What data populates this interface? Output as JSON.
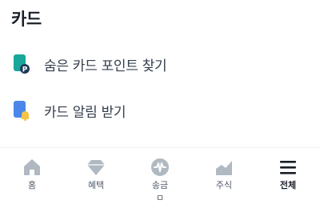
{
  "section": {
    "title": "카드"
  },
  "menu": [
    {
      "label": "숨은 카드 포인트 찾기",
      "icon": "card-point-icon"
    },
    {
      "label": "카드 알림 받기",
      "icon": "card-notification-icon"
    }
  ],
  "tabbar": {
    "tabs": [
      {
        "label": "홈",
        "icon": "home-icon"
      },
      {
        "label": "혜택",
        "icon": "benefit-diamond-icon"
      },
      {
        "label": "송금",
        "icon": "transfer-icon"
      },
      {
        "label": "주식",
        "icon": "stock-chart-icon"
      },
      {
        "label": "전체",
        "icon": "menu-icon"
      }
    ],
    "transfer_overflow": "ㅁ"
  },
  "colors": {
    "teal": "#1aa69a",
    "blue": "#4b87e8",
    "yellow": "#f4c445",
    "icon_gray": "#b0b8c1",
    "active": "#191f28"
  }
}
